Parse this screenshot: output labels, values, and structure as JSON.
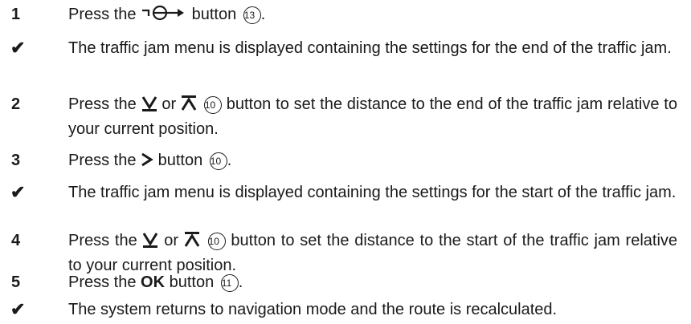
{
  "steps": [
    {
      "marker": "1",
      "kind": "number",
      "pre": "Press the",
      "icon": "traffic-jam-button-icon",
      "post": "button",
      "ref": "13",
      "end": "."
    },
    {
      "marker": "✔",
      "kind": "check",
      "text": "The traffic jam menu is displayed containing the settings for the end of the traffic jam."
    },
    {
      "marker": "2",
      "kind": "number",
      "pre": "Press the",
      "icon1": "arrow-down-icon",
      "mid": "or",
      "icon2": "arrow-up-icon",
      "ref": "10",
      "post": "button to set the distance to the end of the traffic jam relative to your current position."
    },
    {
      "marker": "3",
      "kind": "number",
      "pre": "Press the",
      "icon": "arrow-right-icon",
      "post": "button",
      "ref": "10",
      "end": "."
    },
    {
      "marker": "✔",
      "kind": "check",
      "text": "The traffic jam menu is displayed containing the settings for the start of the traffic jam."
    },
    {
      "marker": "4",
      "kind": "number",
      "pre": "Press the",
      "icon1": "arrow-down-icon",
      "mid": "or",
      "icon2": "arrow-up-icon",
      "ref": "10",
      "post": "button to set the distance to the start of the traffic jam relative to your current position."
    },
    {
      "marker": "5",
      "kind": "number",
      "pre": "Press the",
      "bold": "OK",
      "post": "button",
      "ref": "11",
      "end": "."
    },
    {
      "marker": "✔",
      "kind": "check",
      "text": "The system returns to navigation mode and the route is recalculated."
    }
  ]
}
